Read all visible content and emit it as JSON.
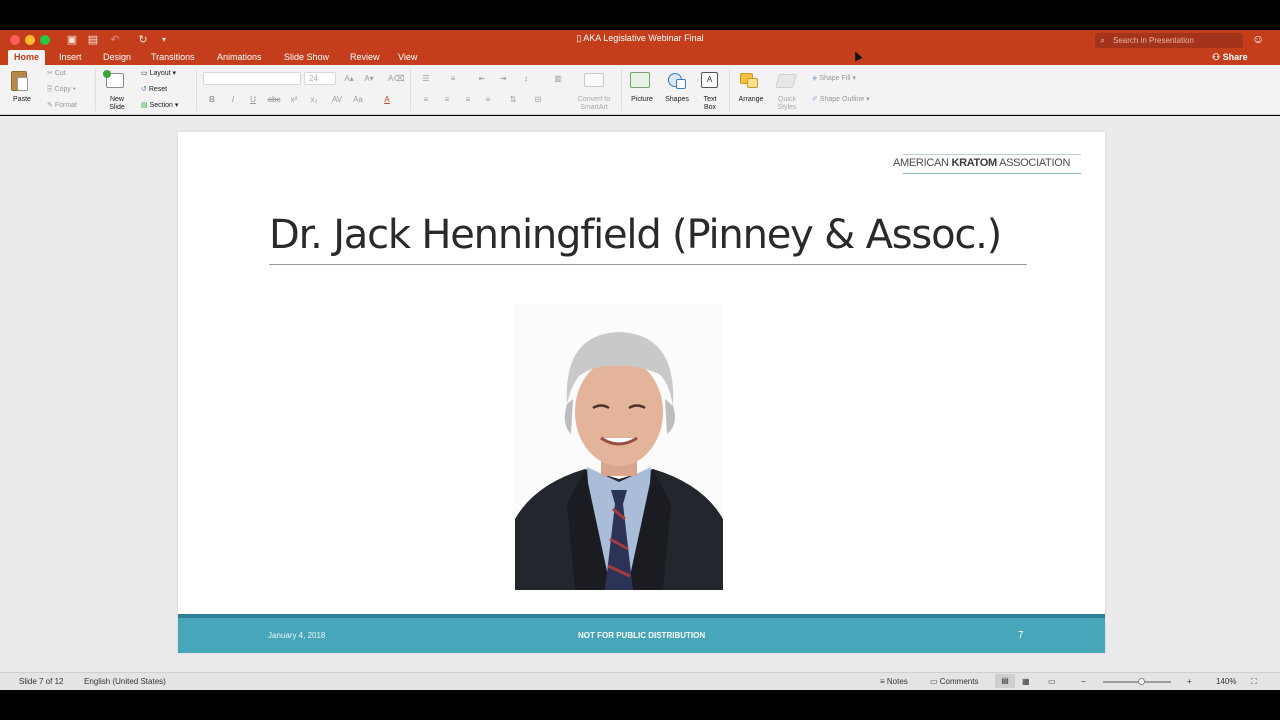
{
  "window": {
    "title": "AKA Legislative Webinar Final",
    "search_placeholder": "Search in Presentation",
    "share_label": "Share"
  },
  "tabs": [
    {
      "label": "Home",
      "active": true
    },
    {
      "label": "Insert"
    },
    {
      "label": "Design"
    },
    {
      "label": "Transitions"
    },
    {
      "label": "Animations"
    },
    {
      "label": "Slide Show"
    },
    {
      "label": "Review"
    },
    {
      "label": "View"
    }
  ],
  "ribbon": {
    "paste": "Paste",
    "cut": "Cut",
    "copy": "Copy",
    "format": "Format",
    "new_slide_1": "New",
    "new_slide_2": "Slide",
    "layout": "Layout",
    "reset": "Reset",
    "section": "Section",
    "font_size": "24",
    "convert_1": "Convert to",
    "convert_2": "SmartArt",
    "picture": "Picture",
    "shapes": "Shapes",
    "textbox_1": "Text",
    "textbox_2": "Box",
    "arrange": "Arrange",
    "quick_1": "Quick",
    "quick_2": "Styles",
    "shape_fill": "Shape Fill",
    "shape_outline": "Shape Outline"
  },
  "slide": {
    "logo_part1": "AMERICAN",
    "logo_part2": "KRATOM",
    "logo_part3": "ASSOCIATION",
    "title": "Dr. Jack Henningfield (Pinney & Assoc.)",
    "footer_date": "January 4, 2018",
    "footer_distribution": "NOT FOR PUBLIC DISTRIBUTION",
    "footer_number": "7"
  },
  "status": {
    "slide_indicator": "Slide 7 of 12",
    "language": "English (United States)",
    "notes": "Notes",
    "comments": "Comments",
    "zoom": "140%"
  },
  "colors": {
    "accent": "#c43e1c",
    "footer_band": "#48a6ba"
  }
}
